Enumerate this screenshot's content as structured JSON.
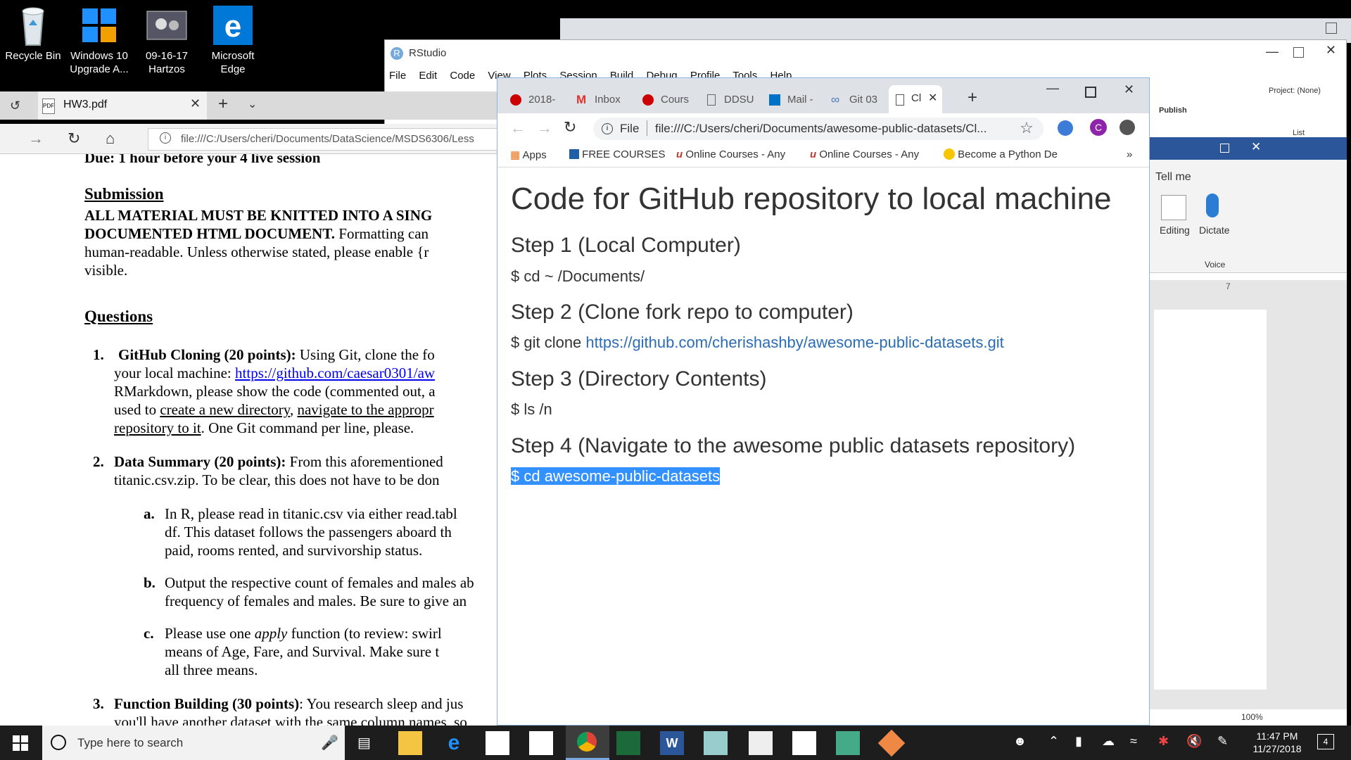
{
  "desktop": {
    "icons": [
      {
        "label": "Recycle Bin"
      },
      {
        "label": "Windows 10 Upgrade A..."
      },
      {
        "label": "09-16-17 Hartzos"
      },
      {
        "label": "Microsoft Edge"
      }
    ]
  },
  "rstudio": {
    "title": "RStudio",
    "menu": [
      "File",
      "Edit",
      "Code",
      "View",
      "Plots",
      "Session",
      "Build",
      "Debug",
      "Profile",
      "Tools",
      "Help"
    ],
    "project": "Project: (None)",
    "publish": "Publish",
    "list": "List"
  },
  "edge": {
    "tab_title": "HW3.pdf",
    "url": "file:///C:/Users/cheri/Documents/DataScience/MSDS6306/Less",
    "pdf": {
      "line0": "Due: 1 hour before your 4",
      "line0b": "live session",
      "submission_heading": "Submission",
      "sub1": "ALL MATERIAL MUST BE KNITTED INTO A SING",
      "sub2a": "DOCUMENTED HTML DOCUMENT.",
      "sub2b": " Formatting can",
      "sub3": "human-readable.  Unless otherwise stated, please enable {r",
      "sub4": "visible.",
      "questions_heading": "Questions",
      "q1_num": "1.",
      "q1_title": "GitHub Cloning (20 points):",
      "q1_text1": " Using Git, clone the fo",
      "q1_text2a": "your local machine: ",
      "q1_link": "https://github.com/caesar0301/aw",
      "q1_text3": "RMarkdown, please show the code (commented out, a",
      "q1_text4a": "used to ",
      "q1_u1": "create a new directory",
      "q1_text4b": ", ",
      "q1_u2": "navigate to the appropr",
      "q1_u3": "repository to it",
      "q1_text5": ".  One Git command per line, please.",
      "q2_num": "2.",
      "q2_title": "Data Summary (20 points):",
      "q2_text1": " From this aforementioned",
      "q2_text2": "titanic.csv.zip.  To be clear, this does not have to be don",
      "qa_label": "a.",
      "qa_1": "In R, please read in titanic.csv via either read.tabl",
      "qa_2": "df.  This dataset follows the passengers aboard th",
      "qa_3": "paid, rooms rented, and survivorship status.",
      "qb_label": "b.",
      "qb_1": "Output the respective count of females and males ab",
      "qb_2": "frequency of females and males.  Be sure to give an",
      "qc_label": "c.",
      "qc_1a": "Please use one ",
      "qc_1i": "apply",
      "qc_1b": " function (to review: swirl",
      "qc_2": "means of Age, Fare, and Survival.  Make sure t",
      "qc_3": "all three means.",
      "q3_num": "3.",
      "q3_title": "Function Building (30 points)",
      "q3_text1": ": You research sleep and jus",
      "q3_text2": "you'll have another dataset with the same column names, so"
    }
  },
  "chrome": {
    "tabs": [
      {
        "label": "2018-"
      },
      {
        "label": "Inbox"
      },
      {
        "label": "Cours"
      },
      {
        "label": "DDSU"
      },
      {
        "label": "Mail -"
      },
      {
        "label": "Git 03"
      },
      {
        "label": "Cl"
      }
    ],
    "file_label": "File",
    "url": "file:///C:/Users/cheri/Documents/awesome-public-datasets/Cl...",
    "profile_initial": "C",
    "bookmarks": [
      {
        "label": "Apps"
      },
      {
        "label": "FREE COURSES"
      },
      {
        "label": "Online Courses - Any"
      },
      {
        "label": "Online Courses - Any"
      },
      {
        "label": "Become a Python De"
      }
    ],
    "more": "»",
    "page": {
      "title": "Code for GitHub repository to local machine",
      "step1": "Step 1 (Local Computer)",
      "cmd1": "$ cd ~ /Documents/",
      "step2": "Step 2 (Clone fork repo to computer)",
      "cmd2_prefix": "$ git clone ",
      "cmd2_link": "https://github.com/cherishashby/awesome-public-datasets.git",
      "step3": "Step 3 (Directory Contents)",
      "cmd3": "$ ls /n",
      "step4": "Step 4 (Navigate to the awesome public datasets repository)",
      "cmd4": "$ cd awesome-public-datasets"
    }
  },
  "word": {
    "tell_me": "Tell me",
    "editing": "Editing",
    "dictate": "Dictate",
    "voice": "Voice",
    "zoom": "100%",
    "ruler_mark": "7"
  },
  "taskbar": {
    "search_placeholder": "Type here to search",
    "time": "11:47 PM",
    "date": "11/27/2018",
    "notifications": "4"
  }
}
